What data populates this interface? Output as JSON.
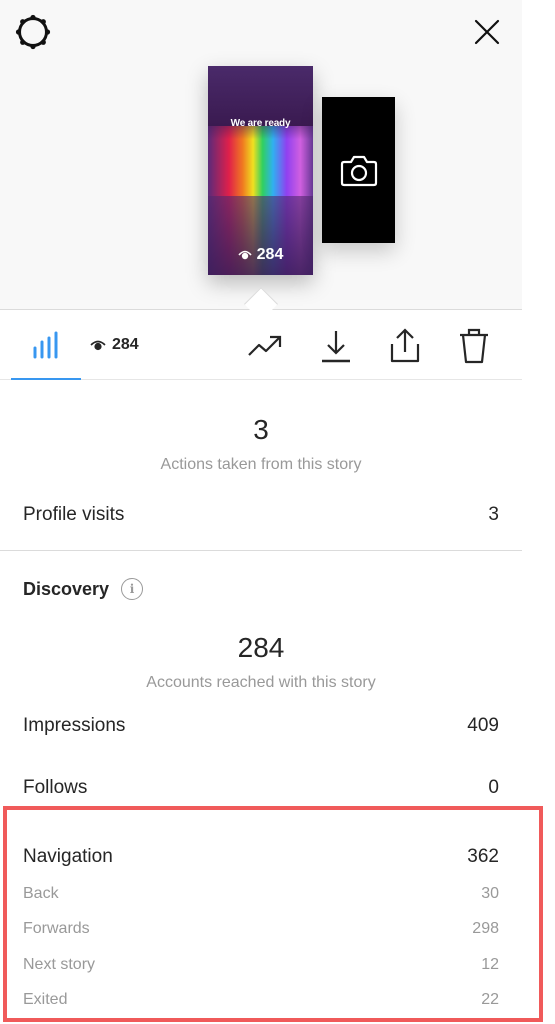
{
  "header": {
    "settings_icon": "gear-icon",
    "close_icon": "close-icon"
  },
  "story_preview": {
    "caption": "We are ready",
    "views": "284",
    "next_thumb_icon": "camera-icon"
  },
  "toolbar": {
    "tabs": [
      {
        "name": "insights",
        "icon": "bar-chart-icon",
        "active": true
      },
      {
        "name": "viewers",
        "icon": "eye-icon",
        "label": "284"
      }
    ],
    "actions": [
      {
        "name": "promote",
        "icon": "trending-up-icon"
      },
      {
        "name": "save",
        "icon": "download-icon"
      },
      {
        "name": "share",
        "icon": "share-icon"
      },
      {
        "name": "delete",
        "icon": "trash-icon"
      }
    ],
    "accent_color": "#3897f0"
  },
  "interactions": {
    "total": "3",
    "caption": "Actions taken from this story",
    "rows": [
      {
        "label": "Profile visits",
        "value": "3"
      }
    ]
  },
  "discovery": {
    "title": "Discovery",
    "total": "284",
    "caption": "Accounts reached with this story",
    "rows": [
      {
        "label": "Impressions",
        "value": "409"
      },
      {
        "label": "Follows",
        "value": "0"
      }
    ]
  },
  "navigation": {
    "label": "Navigation",
    "value": "362",
    "rows": [
      {
        "label": "Back",
        "value": "30"
      },
      {
        "label": "Forwards",
        "value": "298"
      },
      {
        "label": "Next story",
        "value": "12"
      },
      {
        "label": "Exited",
        "value": "22"
      }
    ],
    "highlight_color": "#f05a5a"
  }
}
